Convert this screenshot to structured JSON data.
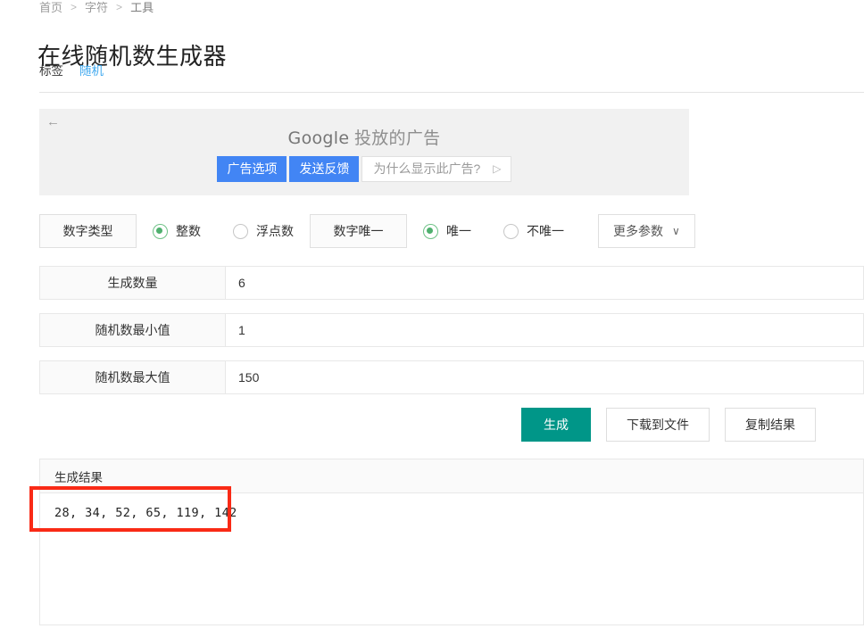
{
  "breadcrumb": {
    "items": [
      "首页",
      "字符",
      "工具"
    ],
    "separator": ">"
  },
  "page_title": "在线随机数生成器",
  "tags": {
    "label": "标签",
    "links": [
      "随机"
    ]
  },
  "ad": {
    "back_icon": "←",
    "brand": "Google",
    "headline_suffix": " 投放的广告",
    "buttons": [
      {
        "label": "广告选项",
        "style": "primary"
      },
      {
        "label": "发送反馈",
        "style": "primary"
      }
    ],
    "why_label": "为什么显示此广告?",
    "why_icon": "▷",
    "background": "#f1f1f1",
    "button_color": "#4285f4"
  },
  "options": {
    "number_type_label": "数字类型",
    "number_type_choices": [
      {
        "label": "整数",
        "selected": true
      },
      {
        "label": "浮点数",
        "selected": false
      }
    ],
    "unique_label": "数字唯一",
    "unique_choices": [
      {
        "label": "唯一",
        "selected": true
      },
      {
        "label": "不唯一",
        "selected": false
      }
    ],
    "more_params_label": "更多参数",
    "more_params_icon": "chevron-down-icon",
    "chevron": "∨",
    "radio_on_color": "#4fb06e"
  },
  "fields": [
    {
      "label": "生成数量",
      "value": "6"
    },
    {
      "label": "随机数最小值",
      "value": "1"
    },
    {
      "label": "随机数最大值",
      "value": "150"
    }
  ],
  "actions": [
    {
      "label": "生成",
      "style": "primary"
    },
    {
      "label": "下载到文件",
      "style": "default"
    },
    {
      "label": "复制结果",
      "style": "default"
    }
  ],
  "result": {
    "header": "生成结果",
    "text": "28, 34, 52, 65, 119, 142",
    "values": [
      28,
      34,
      52,
      65,
      119,
      142
    ]
  },
  "annotation": {
    "color": "#f92a16"
  },
  "theme": {
    "primary": "#009688",
    "link": "#41a9ef",
    "border": "#e8e8e8"
  }
}
